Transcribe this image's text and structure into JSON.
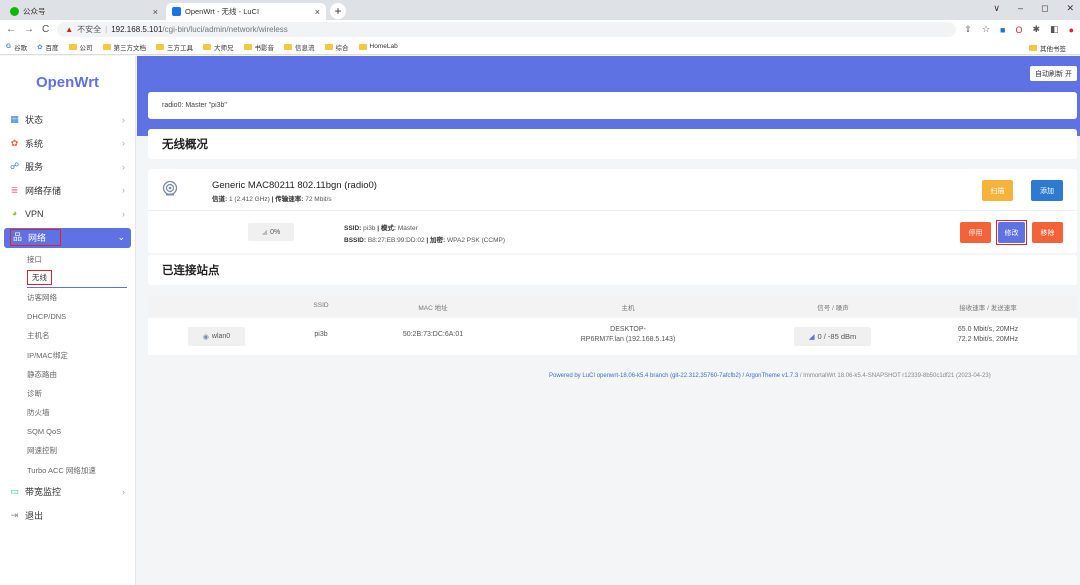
{
  "browser": {
    "tabs": [
      {
        "title": "公众号",
        "close": "×",
        "icon_color": "#09bb07"
      },
      {
        "title": "OpenWrt - 无线 - LuCI",
        "close": "×",
        "icon_color": "#1a73e8"
      }
    ],
    "new_tab": "+",
    "window_controls": [
      "∨",
      "–",
      "◻",
      "✕"
    ],
    "nav": {
      "back": "←",
      "forward": "→",
      "reload": "C"
    },
    "address": {
      "security": "不安全",
      "host": "192.168.5.101",
      "path": "/cgi-bin/luci/admin/network/wireless"
    },
    "bookmarks": [
      "谷歌",
      "百度",
      "公司",
      "第三方文档",
      "三方工具",
      "大师兄",
      "书影音",
      "信息流",
      "综合",
      "HomeLab"
    ],
    "bookmark_right": "其他书签"
  },
  "sidebar": {
    "logo": "OpenWrt",
    "items": [
      {
        "label": "状态",
        "icon": "grid-icon",
        "color": "#2e7ad1"
      },
      {
        "label": "系统",
        "icon": "gear-icon",
        "color": "#f4623a"
      },
      {
        "label": "服务",
        "icon": "share-icon",
        "color": "#2e7ad1"
      },
      {
        "label": "网络存储",
        "icon": "storage-icon",
        "color": "#f46b8b"
      },
      {
        "label": "VPN",
        "icon": "vpn-icon",
        "color": "#8bc34a"
      },
      {
        "label": "网络",
        "icon": "network-icon",
        "color": "#ffffff"
      }
    ],
    "submenu": [
      "接口",
      "无线",
      "访客网络",
      "DHCP/DNS",
      "主机名",
      "IP/MAC绑定",
      "静态路由",
      "诊断",
      "防火墙",
      "SQM QoS",
      "网速控制",
      "Turbo ACC 网络加速"
    ],
    "bottom_items": [
      {
        "label": "带宽监控",
        "icon": "monitor-icon",
        "color": "#2dce89"
      },
      {
        "label": "退出",
        "icon": "logout-icon",
        "color": "#888888"
      }
    ]
  },
  "main": {
    "refresh_button": "自动刷新 开",
    "alert": "radio0: Master \"pi3b\"",
    "overview_title": "无线概况",
    "radio": {
      "name": "Generic MAC80211 802.11bgn (radio0)",
      "channel_label": "信道:",
      "channel_value": "1 (2.412 GHz)",
      "sep": "|",
      "rate_label": "传输速率:",
      "rate_value": "72 Mbit/s",
      "scan": "扫描",
      "add": "添加"
    },
    "network": {
      "signal": "0%",
      "ssid_label": "SSID:",
      "ssid": "pi3b",
      "mode_label": "模式:",
      "mode": "Master",
      "bssid_label": "BSSID:",
      "bssid": "B8:27:EB:99:DD:02",
      "enc_label": "加密:",
      "enc": "WPA2 PSK (CCMP)",
      "disable": "停用",
      "edit": "修改",
      "remove": "移除"
    },
    "stations_title": "已连接站点",
    "table": {
      "headers": [
        "SSID",
        "MAC 地址",
        "主机",
        "信号 / 噪声",
        "接收速率 / 发送速率"
      ],
      "row": {
        "iface": "wlan0",
        "ssid": "pi3b",
        "mac": "50:2B:73:DC:6A:01",
        "host_line1": "DESKTOP-",
        "host_line2": "RP6RM7F.lan (192.168.5.143)",
        "signal": "0 / -85 dBm",
        "rx": "65.0 Mbit/s, 20MHz",
        "tx": "72.2 Mbit/s, 20MHz"
      }
    },
    "footer": {
      "link": "Powered by LuCI openwrt-18.06-k5.4 branch (git-22.312.35760-7afcfb2) / ArgonTheme v1.7.3",
      "rest": " / ImmortalWrt 18.06-k5.4-SNAPSHOT r12339-8b50c1df21 (2023-04-23)"
    }
  },
  "colors": {
    "accent": "#5e72e4",
    "warning": "#f5b33b",
    "primary": "#2e7ad1",
    "danger": "#f4623a",
    "highlight": "#e0222b"
  }
}
